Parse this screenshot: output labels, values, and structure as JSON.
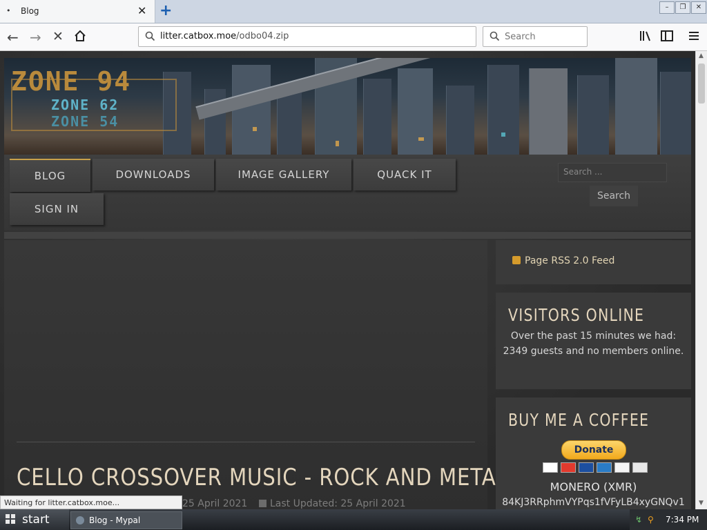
{
  "browser": {
    "tab_title": "Blog",
    "tab_dot": "•",
    "url_domain": "litter.catbox.moe",
    "url_path": "/odbo04.zip",
    "search_placeholder": "Search",
    "status": "Waiting for litter.catbox.moe...",
    "win_controls": [
      "–",
      "❐",
      "✕"
    ]
  },
  "site": {
    "logo_main": "ZONE 94",
    "logo_sub1": "ZONE 62",
    "logo_sub2": "ZONE 54",
    "menu": [
      "BLOG",
      "DOWNLOADS",
      "IMAGE GALLERY",
      "QUACK IT",
      "SIGN IN"
    ],
    "search_placeholder": "Search ...",
    "search_button": "Search"
  },
  "article": {
    "title": "CELLO CROSSOVER MUSIC - ROCK AND METAL",
    "published": "25 April 2021",
    "updated": "Last Updated: 25 April 2021"
  },
  "sidebar": {
    "rss_label": "Page RSS 2.0 Feed",
    "visitors_heading": "VISITORS ONLINE",
    "visitors_text": "Over the past 15 minutes we had: 2349 guests and no members online.",
    "coffee_heading": "BUY ME A COFFEE",
    "donate_label": "Donate",
    "monero_label": "MONERO (XMR)",
    "monero_address": "84KJ3RRphmVYPqs1fVFyLB4xyGNQv1"
  },
  "taskbar": {
    "start_label": "start",
    "task_label": "Blog - Mypal",
    "clock": "7:34 PM"
  },
  "colors": {
    "accent_gold": "#c9a14a",
    "heading_cream": "#e4d6bd",
    "paypal_yellow": "#f2a91c"
  }
}
